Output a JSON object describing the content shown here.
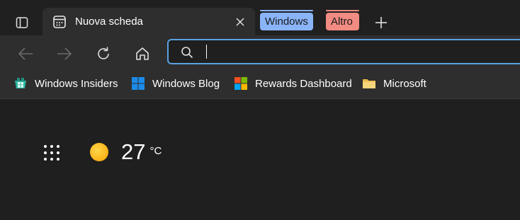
{
  "tabstrip": {
    "active_tab": {
      "title": "Nuova scheda"
    },
    "groups": [
      {
        "label": "Windows",
        "color": "#8ab4f8"
      },
      {
        "label": "Altro",
        "color": "#f28b82"
      }
    ]
  },
  "icons": {
    "tab_actions": "tab-actions-icon",
    "new_tab": "plus-icon",
    "back": "arrow-left-icon",
    "forward": "arrow-right-icon",
    "refresh": "refresh-icon",
    "home": "home-icon",
    "search": "search-icon",
    "apps": "grid-icon",
    "weather": "sun-icon"
  },
  "address_bar": {
    "value": "",
    "placeholder": ""
  },
  "favorites": [
    {
      "label": "Windows Insiders",
      "icon": "windows-insider-icon"
    },
    {
      "label": "Windows Blog",
      "icon": "windows-logo-icon"
    },
    {
      "label": "Rewards Dashboard",
      "icon": "microsoft-logo-icon"
    },
    {
      "label": "Microsoft",
      "icon": "folder-icon"
    }
  ],
  "weather": {
    "temperature": "27",
    "unit": "°C"
  },
  "colors": {
    "accent": "#5ca0e3",
    "background": "#1f1f1f",
    "toolbar": "#2e2e2e"
  }
}
